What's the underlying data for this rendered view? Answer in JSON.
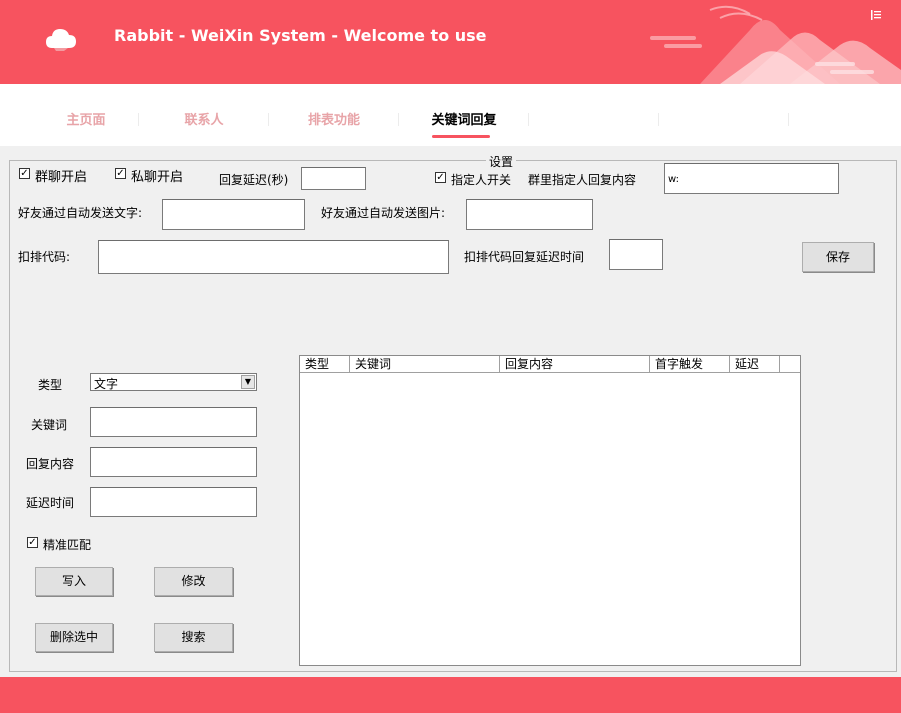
{
  "header": {
    "title": "Rabbit - WeiXin System - Welcome to use",
    "accent_color": "#f7535f",
    "logo_icon": "cloud-icon",
    "menu_icon": "list-menu-icon"
  },
  "nav": {
    "tabs": [
      {
        "label": "主页面",
        "active": false
      },
      {
        "label": "联系人",
        "active": false
      },
      {
        "label": "排表功能",
        "active": false
      },
      {
        "label": "关键词回复",
        "active": true
      }
    ]
  },
  "settings": {
    "legend": "设置",
    "group_chat_label": "群聊开启",
    "group_chat_checked": true,
    "private_chat_label": "私聊开启",
    "private_chat_checked": true,
    "reply_delay_label": "回复延迟(秒)",
    "reply_delay_value": "",
    "designated_switch_label": "指定人开关",
    "designated_switch_checked": true,
    "designated_reply_label": "群里指定人回复内容",
    "designated_reply_value": "w:",
    "friend_text_label": "好友通过自动发送文字:",
    "friend_text_value": "",
    "friend_image_label": "好友通过自动发送图片:",
    "friend_image_value": "",
    "kick_code_label": "扣排代码:",
    "kick_code_value": "",
    "kick_delay_label": "扣排代码回复延迟时间",
    "kick_delay_value": "",
    "save_label": "保存"
  },
  "keyword_form": {
    "type_label": "类型",
    "type_value": "文字",
    "keyword_label": "关键词",
    "keyword_value": "",
    "reply_label": "回复内容",
    "reply_value": "",
    "delay_label": "延迟时间",
    "delay_value": "",
    "exact_match_label": "精准匹配",
    "exact_match_checked": true,
    "write_label": "写入",
    "modify_label": "修改",
    "delete_label": "删除选中",
    "search_label": "搜索"
  },
  "table": {
    "columns": [
      "类型",
      "关键词",
      "回复内容",
      "首字触发",
      "延迟"
    ],
    "rows": []
  }
}
